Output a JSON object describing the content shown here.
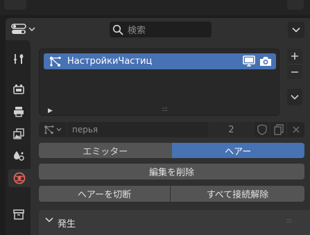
{
  "search": {
    "placeholder": "検索"
  },
  "particle_list": {
    "items": [
      {
        "label": "НастройкиЧастиц"
      }
    ]
  },
  "particle_settings": {
    "name": "перья",
    "users": "2"
  },
  "type_toggle": {
    "emitter": "エミッター",
    "hair": "ヘアー",
    "selected": "ヘアー"
  },
  "buttons": {
    "delete_edit": "編集を削除",
    "cut_hair": "ヘアーを切断",
    "disconnect_all": "すべて接続解除"
  },
  "panels": {
    "emission": "発生"
  },
  "tabs": [
    "tool",
    "render",
    "output",
    "view-layer",
    "particles",
    "physics",
    "constraints"
  ],
  "colors": {
    "selected": "#4772b3",
    "panel_bg": "#303030",
    "button": "#545454"
  }
}
